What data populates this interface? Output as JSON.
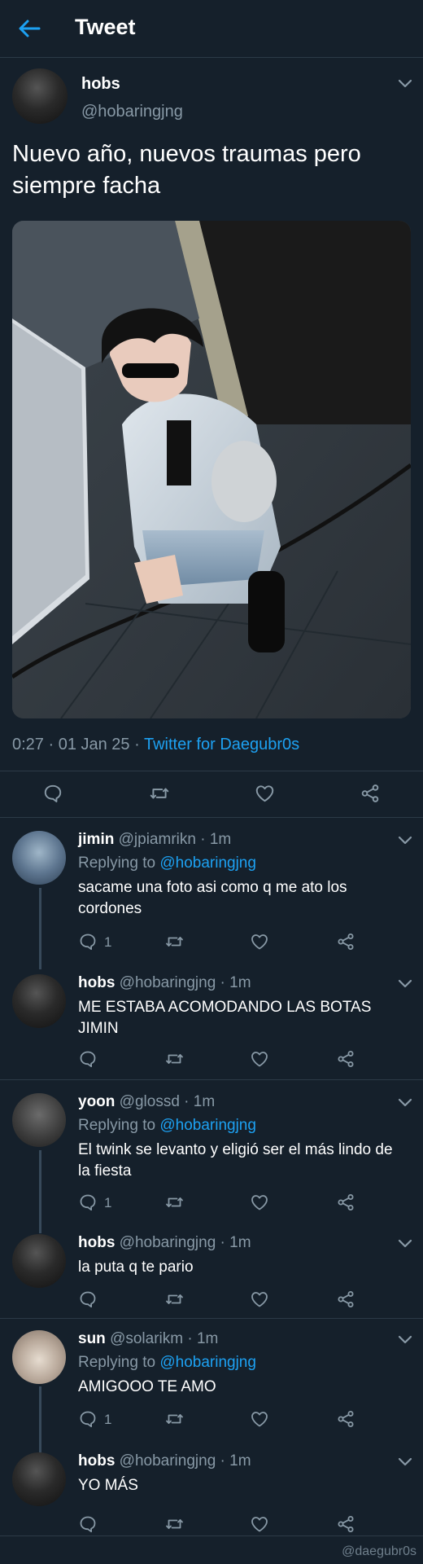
{
  "header": {
    "title": "Tweet"
  },
  "tweet": {
    "name": "hobs",
    "handle": "@hobaringjng",
    "text": "Nuevo año, nuevos traumas pero siempre facha",
    "timestamp": "0:27 · 01 Jan 25 · ",
    "source": "Twitter for Daegubr0s"
  },
  "replies": [
    {
      "name": "jimin",
      "meta": "@jpiamrikn · 1m",
      "replying_prefix": "Replying to ",
      "replying_handle": "@hobaringjng",
      "text": "sacame una foto asi como q me ato los cordones",
      "reply_count": "1"
    },
    {
      "name": "hobs",
      "meta": "@hobaringjng · 1m",
      "text": "ME ESTABA ACOMODANDO LAS BOTAS JIMIN"
    },
    {
      "name": "yoon",
      "meta": "@glossd · 1m",
      "replying_prefix": "Replying to ",
      "replying_handle": "@hobaringjng",
      "text": "El twink se levanto y eligió ser el más lindo de la fiesta",
      "reply_count": "1"
    },
    {
      "name": "hobs",
      "meta": "@hobaringjng · 1m",
      "text": "la puta q te pario"
    },
    {
      "name": "sun",
      "meta": "@solarikm · 1m",
      "replying_prefix": "Replying to ",
      "replying_handle": "@hobaringjng",
      "text": "AMIGOOO TE AMO",
      "reply_count": "1"
    },
    {
      "name": "hobs",
      "meta": "@hobaringjng · 1m",
      "text": "YO MÁS"
    }
  ],
  "watermark": "@daegubr0s",
  "colors": {
    "background": "#15202b",
    "accent": "#1da1f2",
    "muted": "#8899a6",
    "divider": "#2c3a47"
  },
  "icons": [
    "back-arrow-icon",
    "chevron-down-icon",
    "reply-icon",
    "retweet-icon",
    "like-icon",
    "share-icon"
  ]
}
